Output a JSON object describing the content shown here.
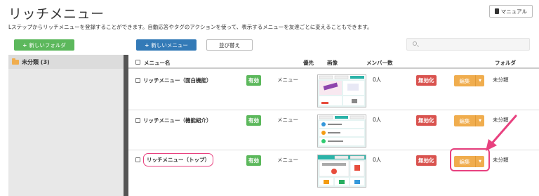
{
  "header": {
    "title": "リッチメニュー",
    "manual_label": "マニュアル",
    "description": "Lステップからリッチメニューを登録することができます。自動応答やタグのアクションを使って、表示するメニューを友達ごとに変えることもできます。"
  },
  "toolbar": {
    "new_folder_label": "新しいフォルダ",
    "new_menu_label": "新しいメニュー",
    "sort_label": "並び替え",
    "search_placeholder": ""
  },
  "sidebar": {
    "folders": [
      {
        "label": "未分類 (3)"
      }
    ]
  },
  "table": {
    "columns": {
      "name": "メニュー名",
      "priority": "優先",
      "image": "画像",
      "members": "メンバー数",
      "folder": "フォルダ"
    },
    "rows": [
      {
        "name": "リッチメニュー（面白機能）",
        "status": "有効",
        "type": "メニュー",
        "members": "0人",
        "disable": "無効化",
        "edit": "編集",
        "folder": "未分類"
      },
      {
        "name": "リッチメニュー（機能紹介）",
        "status": "有効",
        "type": "メニュー",
        "members": "0人",
        "disable": "無効化",
        "edit": "編集",
        "folder": "未分類"
      },
      {
        "name": "リッチメニュー（トップ）",
        "status": "有効",
        "type": "メニュー",
        "members": "0人",
        "disable": "無効化",
        "edit": "編集",
        "folder": "未分類"
      }
    ]
  },
  "colors": {
    "green": "#5cb85c",
    "blue": "#337ab7",
    "orange": "#f0ad4e",
    "red": "#d9534f",
    "highlight": "#e8417f"
  }
}
